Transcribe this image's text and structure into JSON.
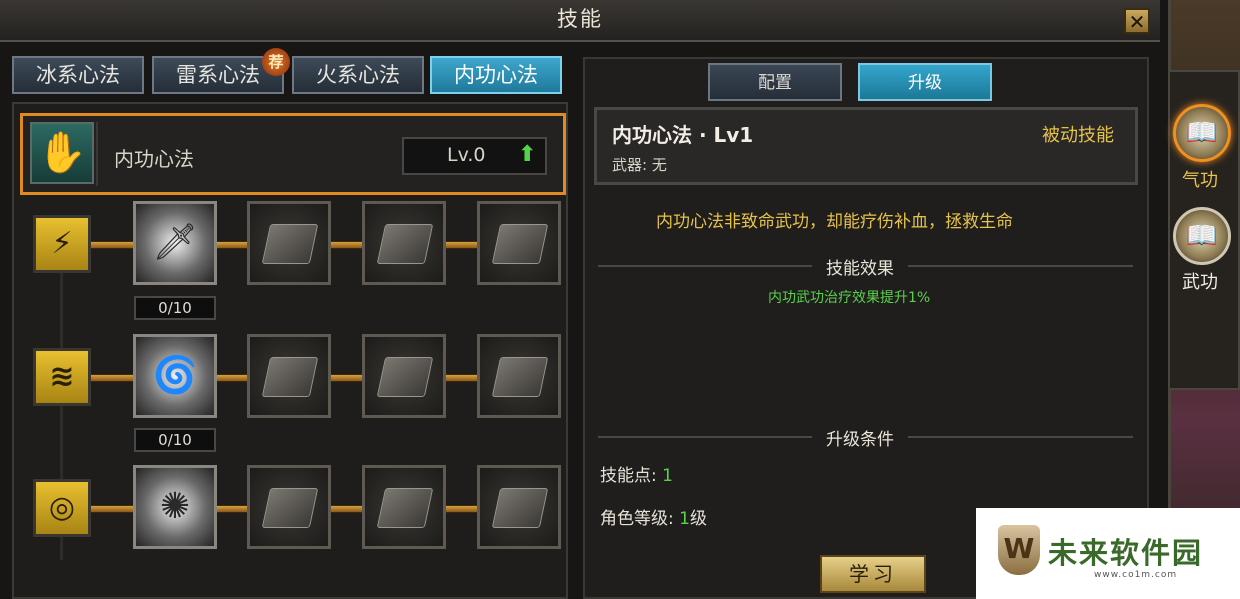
{
  "window": {
    "title": "技能",
    "close_label": "✕"
  },
  "tabs": [
    {
      "label": "冰系心法",
      "active": false
    },
    {
      "label": "雷系心法",
      "active": false
    },
    {
      "label": "火系心法",
      "active": false
    },
    {
      "label": "内功心法",
      "active": true
    }
  ],
  "recommend_badge": "荐",
  "header": {
    "name": "内功心法",
    "level": "Lv.0",
    "upgrade_arrow": "⬆"
  },
  "rows": [
    {
      "type_icon": "bolt-icon",
      "type_glyph": "⚡",
      "counter": "0/10"
    },
    {
      "type_icon": "vortex-icon",
      "type_glyph": "≋",
      "counter": "0/10"
    },
    {
      "type_icon": "swirl-icon",
      "type_glyph": "◎",
      "counter": ""
    }
  ],
  "right_tabs": {
    "config": "配置",
    "upgrade": "升级"
  },
  "info": {
    "title": "内功心法 · Lv1",
    "type": "被动技能",
    "weapon": "武器: 无"
  },
  "description": "内功心法非致命武功，却能疗伤补血，拯救生命",
  "effect_section": "技能效果",
  "effect_text": "内功武功治疗效果提升1%",
  "conditions_section": "升级条件",
  "conditions": {
    "points_label": "技能点:",
    "points_value": "1",
    "level_label": "角色等级:",
    "level_value": "1",
    "level_unit": "级"
  },
  "learn_button": "学习",
  "side_tabs": [
    {
      "label": "气功",
      "active": true
    },
    {
      "label": "武功",
      "active": false
    }
  ],
  "watermark": {
    "name": "未来软件园",
    "url": "www.co1m.com",
    "shield": "W"
  },
  "colors": {
    "accent_orange": "#e08a22",
    "active_tab": "#3da7cc",
    "gold_text": "#e6c24a",
    "green_text": "#58d24a"
  }
}
